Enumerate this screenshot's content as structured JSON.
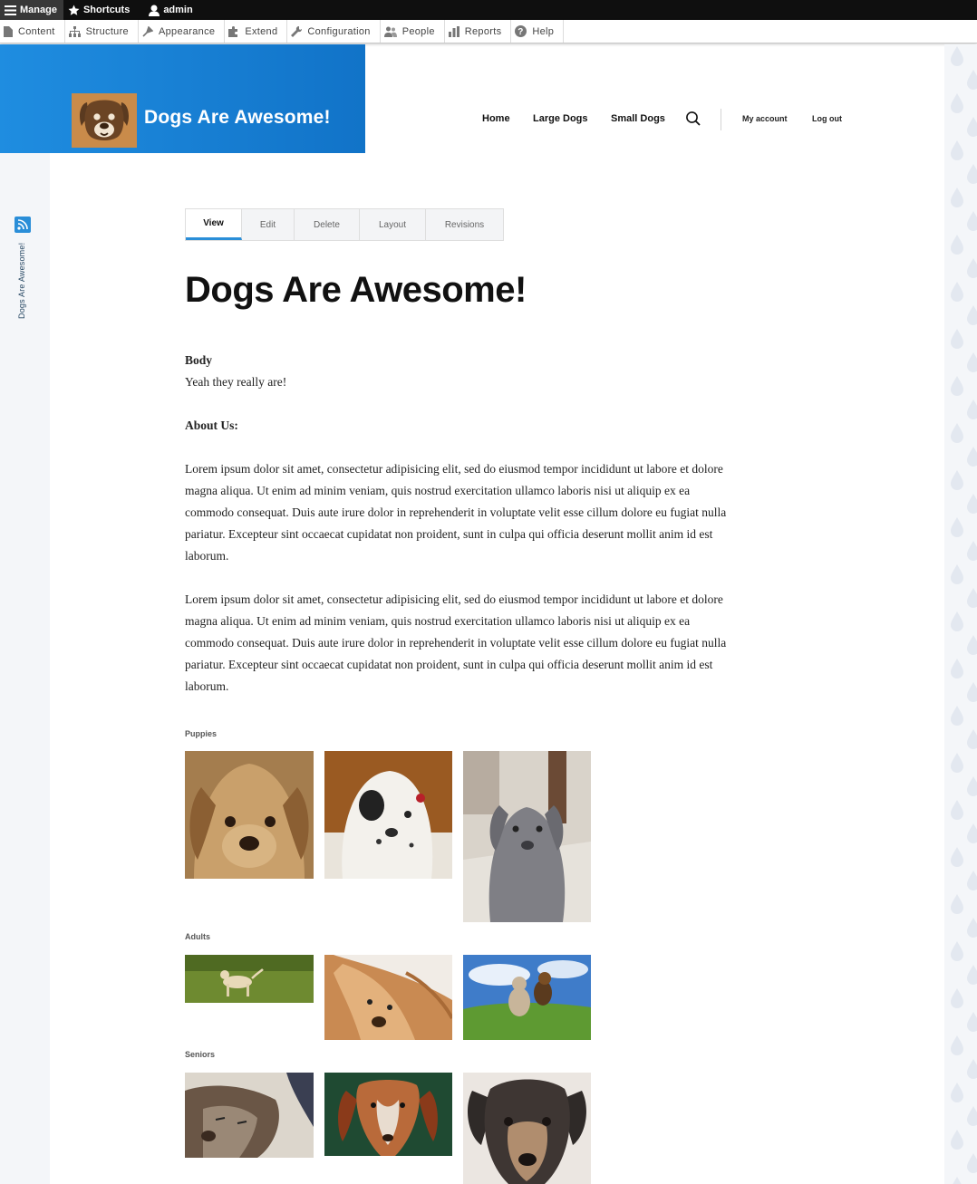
{
  "toolbar": {
    "manage": "Manage",
    "shortcuts": "Shortcuts",
    "user": "admin"
  },
  "tray": {
    "items": [
      "Content",
      "Structure",
      "Appearance",
      "Extend",
      "Configuration",
      "People",
      "Reports",
      "Help"
    ]
  },
  "header": {
    "site_name": "Dogs Are Awesome!",
    "logo_icon": "dog-face-logo",
    "nav": [
      "Home",
      "Large Dogs",
      "Small Dogs"
    ],
    "account": [
      "My account",
      "Log out"
    ]
  },
  "sidebar": {
    "vertical_title": "Dogs Are Awesome!"
  },
  "tabs": [
    "View",
    "Edit",
    "Delete",
    "Layout",
    "Revisions"
  ],
  "node": {
    "title": "Dogs Are Awesome!",
    "body_label": "Body",
    "body_text": "Yeah they really are!",
    "about_heading": "About Us:",
    "paragraph_1": "Lorem ipsum dolor sit amet, consectetur adipisicing elit, sed do eiusmod tempor incididunt ut labore et dolore magna aliqua. Ut enim ad minim veniam, quis nostrud exercitation ullamco laboris nisi ut aliquip ex ea commodo consequat. Duis aute irure dolor in reprehenderit in voluptate velit esse cillum dolore eu fugiat nulla pariatur. Excepteur sint occaecat cupidatat non proident, sunt in culpa qui officia deserunt mollit anim id est laborum.",
    "paragraph_2": "Lorem ipsum dolor sit amet, consectetur adipisicing elit, sed do eiusmod tempor incididunt ut labore et dolore magna aliqua. Ut enim ad minim veniam, quis nostrud exercitation ullamco laboris nisi ut aliquip ex ea commodo consequat. Duis aute irure dolor in reprehenderit in voluptate velit esse cillum dolore eu fugiat nulla pariatur. Excepteur sint occaecat cupidatat non proident, sunt in culpa qui officia deserunt mollit anim id est laborum."
  },
  "galleries": {
    "puppies_label": "Puppies",
    "adults_label": "Adults",
    "seniors_label": "Seniors"
  },
  "colors": {
    "brand_blue": "#1f8de0",
    "tab_accent": "#2a8ed8",
    "toolbar_black": "#0f0f0f"
  }
}
